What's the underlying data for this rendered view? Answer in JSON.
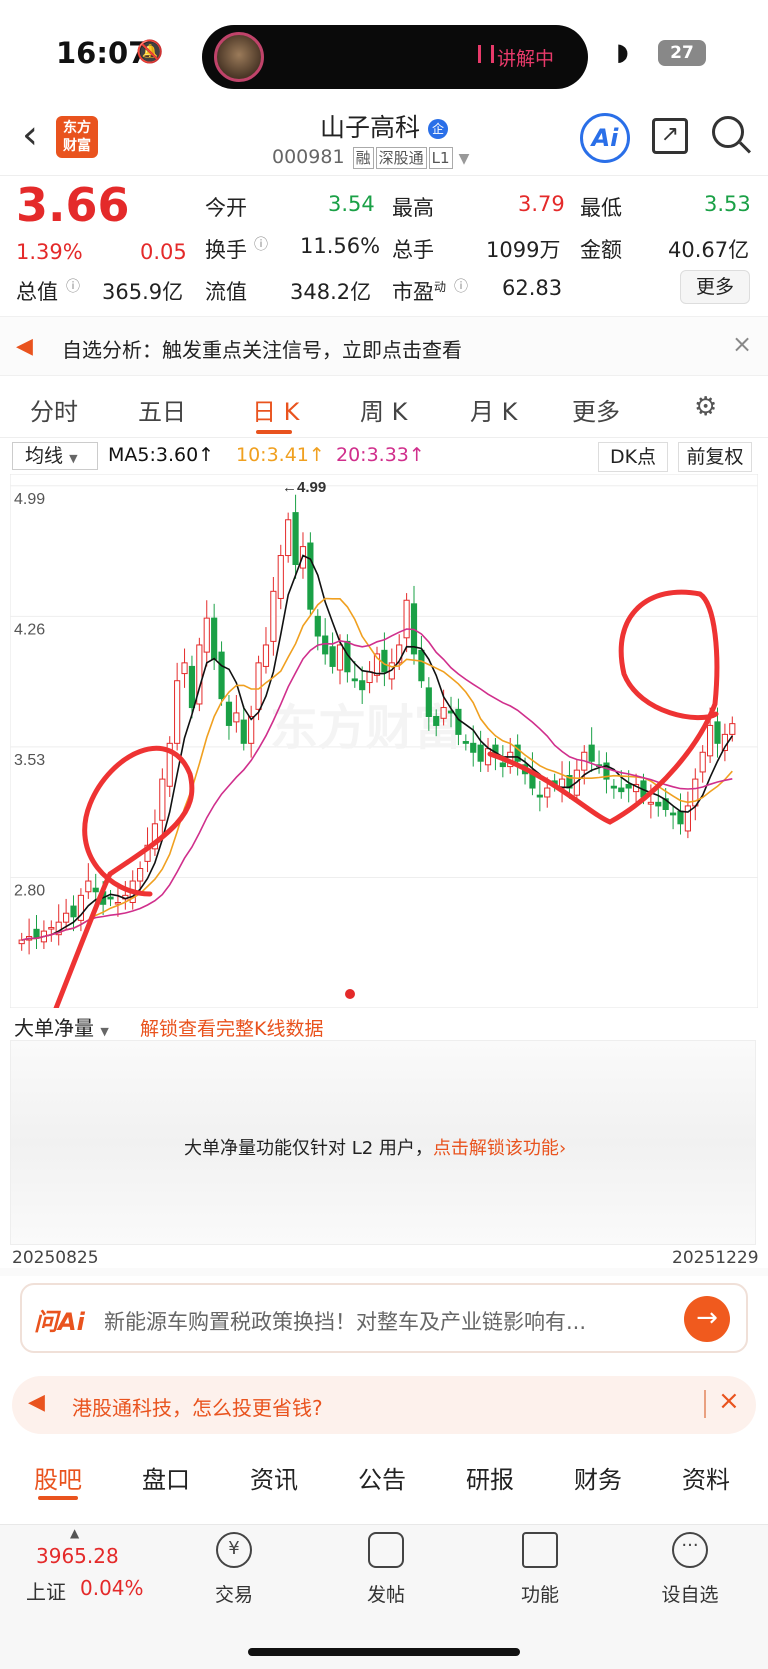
{
  "status": {
    "time": "16:07",
    "live_label": "讲解中",
    "battery": "27"
  },
  "header": {
    "logo": "东方财富",
    "title": "山子高科",
    "code": "000981",
    "tags": [
      "融",
      "深股通",
      "L1"
    ],
    "ai": "Ai"
  },
  "quote": {
    "price": "3.66",
    "change_pct": "1.39%",
    "change": "0.05",
    "open_label": "今开",
    "open": "3.54",
    "high_label": "最高",
    "high": "3.79",
    "low_label": "最低",
    "low": "3.53",
    "turnover_label": "换手",
    "turnover": "11.56%",
    "volume_label": "总手",
    "volume": "1099万",
    "amount_label": "金额",
    "amount": "40.67亿",
    "mcap_label": "总值",
    "mcap": "365.9亿",
    "float_label": "流值",
    "float": "348.2亿",
    "pe_label": "市盈",
    "pe_sup": "动",
    "pe": "62.83",
    "more": "更多"
  },
  "notice": {
    "text": "自选分析：触发重点关注信号，立即点击查看"
  },
  "tabs": [
    "分时",
    "五日",
    "日 K",
    "周 K",
    "月 K",
    "更多"
  ],
  "chart": {
    "ma_selector": "均线",
    "ma5": "MA5:3.60↑",
    "ma10": "10:3.41↑",
    "ma20": "20:3.33↑",
    "dk": "DK点",
    "adjust": "前复权",
    "y_labels": [
      "4.99",
      "4.26",
      "3.53",
      "2.80"
    ],
    "max_marker": "←4.99",
    "watermark": "东方财富",
    "colors": {
      "up": "#e42a2a",
      "down": "#1aa046",
      "ma5": "#111111",
      "ma10": "#f0a020",
      "ma20": "#d02f8c"
    }
  },
  "chart_data": {
    "type": "candlestick",
    "y_range": [
      2.4,
      5.0
    ],
    "max_label": "4.99",
    "closes": [
      2.45,
      2.47,
      2.46,
      2.5,
      2.52,
      2.55,
      2.6,
      2.58,
      2.7,
      2.78,
      2.72,
      2.65,
      2.68,
      2.66,
      2.7,
      2.78,
      2.85,
      2.98,
      3.1,
      3.35,
      3.55,
      3.9,
      4.0,
      3.75,
      4.1,
      4.25,
      4.02,
      3.8,
      3.65,
      3.72,
      3.55,
      3.7,
      4.0,
      4.1,
      4.4,
      4.6,
      4.8,
      4.55,
      4.65,
      4.3,
      4.15,
      4.05,
      3.98,
      4.1,
      3.95,
      3.9,
      3.85,
      3.95,
      4.05,
      3.95,
      4.0,
      4.1,
      4.35,
      4.05,
      3.9,
      3.7,
      3.65,
      3.75,
      3.72,
      3.6,
      3.55,
      3.5,
      3.45,
      3.52,
      3.48,
      3.42,
      3.5,
      3.45,
      3.38,
      3.3,
      3.25,
      3.3,
      3.32,
      3.35,
      3.3,
      3.4,
      3.5,
      3.45,
      3.42,
      3.35,
      3.3,
      3.28,
      3.3,
      3.32,
      3.25,
      3.22,
      3.2,
      3.18,
      3.15,
      3.1,
      3.2,
      3.35,
      3.5,
      3.65,
      3.55,
      3.6,
      3.66
    ]
  },
  "lower_panel": {
    "indicator": "大单净量",
    "unlock_hint": "解锁查看完整K线数据",
    "message": "大单净量功能仅针对 L2 用户，",
    "link": "点击解锁该功能",
    "start_date": "20250825",
    "end_date": "20251229"
  },
  "ai_bar": {
    "label": "问Ai",
    "text": "新能源车购置税政策换挡！对整车及产业链影响有..."
  },
  "promo": {
    "text": "港股通科技，怎么投更省钱?"
  },
  "subtabs": [
    "股吧",
    "盘口",
    "资讯",
    "公告",
    "研报",
    "财务",
    "资料"
  ],
  "bottom": {
    "index_value": "3965.28",
    "index_name": "上证",
    "index_change": "0.04%",
    "items": [
      "交易",
      "发帖",
      "功能",
      "设自选"
    ]
  }
}
